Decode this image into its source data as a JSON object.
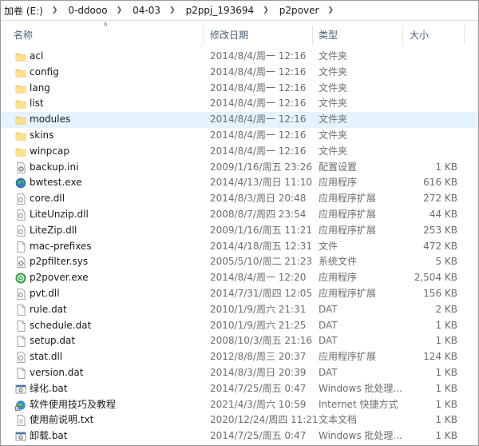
{
  "breadcrumb": [
    "加卷 (E:)",
    "0-ddooo",
    "04-03",
    "p2ppj_193694",
    "p2pover"
  ],
  "columns": {
    "name": "名称",
    "date": "修改日期",
    "type": "类型",
    "size": "大小"
  },
  "files": [
    {
      "name": "acl",
      "date": "2014/8/4/周一 12:16",
      "type": "文件夹",
      "size": "",
      "icon": "folder-icon"
    },
    {
      "name": "config",
      "date": "2014/8/4/周一 12:16",
      "type": "文件夹",
      "size": "",
      "icon": "folder-icon"
    },
    {
      "name": "lang",
      "date": "2014/8/4/周一 12:16",
      "type": "文件夹",
      "size": "",
      "icon": "folder-icon"
    },
    {
      "name": "list",
      "date": "2014/8/4/周一 12:16",
      "type": "文件夹",
      "size": "",
      "icon": "folder-icon"
    },
    {
      "name": "modules",
      "date": "2014/8/4/周一 12:16",
      "type": "文件夹",
      "size": "",
      "icon": "folder-icon",
      "selected": true
    },
    {
      "name": "skins",
      "date": "2014/8/4/周一 12:16",
      "type": "文件夹",
      "size": "",
      "icon": "folder-icon"
    },
    {
      "name": "winpcap",
      "date": "2014/8/4/周一 12:16",
      "type": "文件夹",
      "size": "",
      "icon": "folder-icon"
    },
    {
      "name": "backup.ini",
      "date": "2009/1/16/周五 23:26",
      "type": "配置设置",
      "size": "1 KB",
      "icon": "settings-file-icon"
    },
    {
      "name": "bwtest.exe",
      "date": "2014/4/13/周日 11:10",
      "type": "应用程序",
      "size": "616 KB",
      "icon": "globe-app-icon"
    },
    {
      "name": "core.dll",
      "date": "2014/8/3/周日 20:48",
      "type": "应用程序扩展",
      "size": "272 KB",
      "icon": "dll-file-icon"
    },
    {
      "name": "LiteUnzip.dll",
      "date": "2008/8/7/周四 23:54",
      "type": "应用程序扩展",
      "size": "44 KB",
      "icon": "dll-file-icon"
    },
    {
      "name": "LiteZip.dll",
      "date": "2009/1/16/周五 11:21",
      "type": "应用程序扩展",
      "size": "253 KB",
      "icon": "dll-file-icon"
    },
    {
      "name": "mac-prefixes",
      "date": "2014/4/18/周五 12:31",
      "type": "文件",
      "size": "472 KB",
      "icon": "blank-file-icon"
    },
    {
      "name": "p2pfilter.sys",
      "date": "2005/5/10/周二 21:23",
      "type": "系统文件",
      "size": "5 KB",
      "icon": "sys-file-icon"
    },
    {
      "name": "p2pover.exe",
      "date": "2014/8/4/周一 12:20",
      "type": "应用程序",
      "size": "2,504 KB",
      "icon": "p2pover-app-icon"
    },
    {
      "name": "pvt.dll",
      "date": "2014/7/31/周四 12:05",
      "type": "应用程序扩展",
      "size": "156 KB",
      "icon": "dll-file-icon"
    },
    {
      "name": "rule.dat",
      "date": "2010/1/9/周六 21:31",
      "type": "DAT",
      "size": "2 KB",
      "icon": "blank-file-icon"
    },
    {
      "name": "schedule.dat",
      "date": "2010/1/9/周六 21:25",
      "type": "DAT",
      "size": "1 KB",
      "icon": "blank-file-icon"
    },
    {
      "name": "setup.dat",
      "date": "2008/10/3/周五 21:16",
      "type": "DAT",
      "size": "1 KB",
      "icon": "blank-file-icon"
    },
    {
      "name": "stat.dll",
      "date": "2012/8/8/周三 20:37",
      "type": "应用程序扩展",
      "size": "124 KB",
      "icon": "dll-file-icon"
    },
    {
      "name": "version.dat",
      "date": "2014/8/3/周日 20:39",
      "type": "DAT",
      "size": "1 KB",
      "icon": "blank-file-icon"
    },
    {
      "name": "绿化.bat",
      "date": "2014/7/25/周五 0:47",
      "type": "Windows 批处理...",
      "size": "1 KB",
      "icon": "bat-file-icon"
    },
    {
      "name": "软件使用技巧及教程",
      "date": "2021/4/3/周六 10:59",
      "type": "Internet 快捷方式",
      "size": "1 KB",
      "icon": "internet-shortcut-icon"
    },
    {
      "name": "使用前说明.txt",
      "date": "2020/12/24/周四 11:21",
      "type": "文本文档",
      "size": "1 KB",
      "icon": "text-file-icon"
    },
    {
      "name": "卸载.bat",
      "date": "2014/7/25/周五 0:47",
      "type": "Windows 批处理...",
      "size": "1 KB",
      "icon": "bat-file-icon"
    }
  ]
}
